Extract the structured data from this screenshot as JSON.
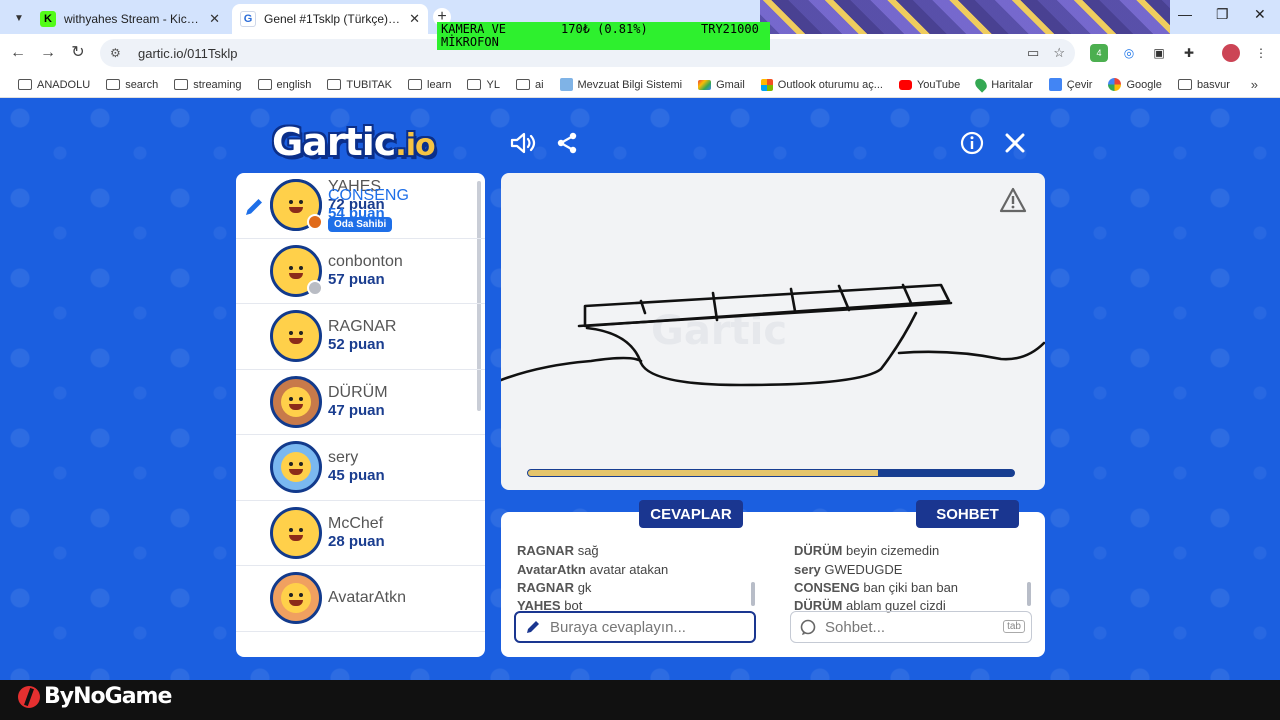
{
  "browser": {
    "tabs": [
      {
        "title": "withyahes Stream - Kick Dashb",
        "favicon": "K"
      },
      {
        "title": "Genel #1Tsklp (Türkçe) - Gartic.",
        "favicon": "G"
      }
    ],
    "url": "gartic.io/011Tsklp",
    "ext_badge": "4",
    "bookmarks": [
      "ANADOLU",
      "search",
      "streaming",
      "english",
      "TUBITAK",
      "learn",
      "YL",
      "ai",
      "Mevzuat Bilgi Sistemi",
      "Gmail",
      "Outlook oturumu aç...",
      "YouTube",
      "Haritalar",
      "Çevir",
      "Google",
      "basvur"
    ]
  },
  "overlay": {
    "line1_a": "KAMERA VE",
    "line1_b": "170₺ (0.81%)",
    "line1_c": "TRY21000",
    "line2": "MİKROFON"
  },
  "game": {
    "logo_main": "Gartic",
    "logo_suffix": ".io",
    "timer_progress": 0.72,
    "players": [
      {
        "name": "YAHES",
        "score": "72 puan",
        "badge": "Oda Sahibi",
        "dot": "#f5c518",
        "avatar_bg": "#ff9ab0",
        "drawing": false
      },
      {
        "name": "conbonton",
        "score": "57 puan",
        "badge": "",
        "dot": "#b9bcc4",
        "avatar_bg": "#ffd04a",
        "drawing": false
      },
      {
        "name": "CONSENG",
        "score": "54 puan",
        "badge": "",
        "dot": "#e06a1a",
        "avatar_bg": "#ffd04a",
        "drawing": true
      },
      {
        "name": "RAGNAR",
        "score": "52 puan",
        "badge": "",
        "dot": "",
        "avatar_bg": "#ffd04a",
        "drawing": false
      },
      {
        "name": "DÜRÜM",
        "score": "47 puan",
        "badge": "",
        "dot": "",
        "avatar_bg": "#c87a4a",
        "drawing": false
      },
      {
        "name": "sery",
        "score": "45 puan",
        "badge": "",
        "dot": "",
        "avatar_bg": "#7ab8f0",
        "drawing": false
      },
      {
        "name": "McChef",
        "score": "28 puan",
        "badge": "",
        "dot": "",
        "avatar_bg": "#ffd04a",
        "drawing": false
      },
      {
        "name": "AvatarAtkn",
        "score": "",
        "badge": "",
        "dot": "",
        "avatar_bg": "#f0a060",
        "drawing": false
      }
    ],
    "answers_label": "CEVAPLAR",
    "chat_label": "SOHBET",
    "answers": [
      {
        "who": "RAGNAR",
        "text": "sağ"
      },
      {
        "who": "AvatarAtkn",
        "text": "avatar atakan"
      },
      {
        "who": "RAGNAR",
        "text": "gk"
      },
      {
        "who": "YAHES",
        "text": "bot"
      }
    ],
    "chat": [
      {
        "who": "DÜRÜM",
        "text": "beyin cizemedin"
      },
      {
        "who": "sery",
        "text": "GWEDUGDE"
      },
      {
        "who": "CONSENG",
        "text": "ban çiki ban ban"
      },
      {
        "who": "DÜRÜM",
        "text": "ablam guzel cizdi"
      }
    ],
    "answer_placeholder": "Buraya cevaplayın...",
    "chat_placeholder": "Sohbet...",
    "chat_key_hint": "tab"
  },
  "footer": {
    "brand": "ByNoGame"
  }
}
